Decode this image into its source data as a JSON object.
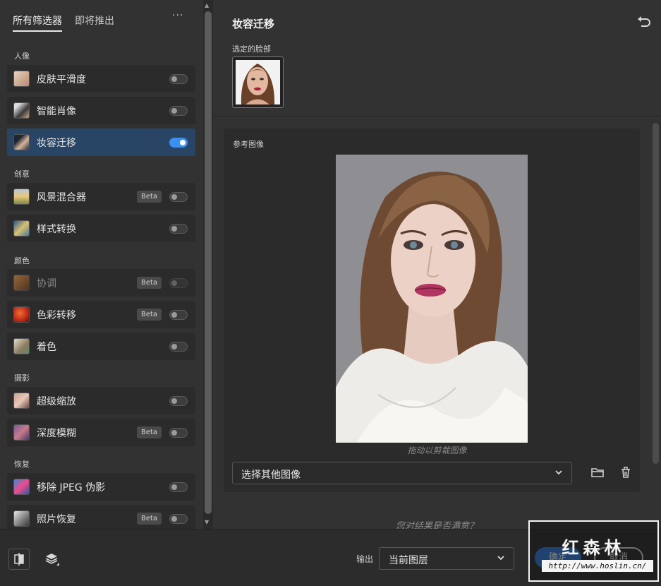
{
  "left_panel": {
    "tabs": [
      {
        "label": "所有筛选器",
        "active": true
      },
      {
        "label": "即将推出",
        "active": false
      }
    ],
    "more_label": "···",
    "sections": [
      {
        "title": "人像",
        "items": [
          {
            "label": "皮肤平滑度",
            "enabled": false,
            "beta": false
          },
          {
            "label": "智能肖像",
            "enabled": false,
            "beta": false
          },
          {
            "label": "妆容迁移",
            "enabled": true,
            "beta": false,
            "selected": true
          }
        ]
      },
      {
        "title": "创意",
        "items": [
          {
            "label": "风景混合器",
            "enabled": false,
            "beta": true
          },
          {
            "label": "样式转换",
            "enabled": false,
            "beta": false
          }
        ]
      },
      {
        "title": "颜色",
        "items": [
          {
            "label": "协调",
            "enabled": false,
            "beta": true,
            "disabled": true
          },
          {
            "label": "色彩转移",
            "enabled": false,
            "beta": true
          },
          {
            "label": "着色",
            "enabled": false,
            "beta": false
          }
        ]
      },
      {
        "title": "摄影",
        "items": [
          {
            "label": "超级缩放",
            "enabled": false,
            "beta": false
          },
          {
            "label": "深度模糊",
            "enabled": false,
            "beta": true
          }
        ]
      },
      {
        "title": "恢复",
        "items": [
          {
            "label": "移除 JPEG 伪影",
            "enabled": false,
            "beta": false
          },
          {
            "label": "照片恢复",
            "enabled": false,
            "beta": true
          }
        ]
      }
    ],
    "beta_label": "Beta"
  },
  "right_panel": {
    "title": "妆容迁移",
    "selected_face_label": "选定的脸部",
    "reference_label": "参考图像",
    "drag_hint": "拖动以剪裁图像",
    "select_image": "选择其他图像",
    "feedback": "您对结果是否满意？"
  },
  "bottom_bar": {
    "output_label": "输出",
    "output_value": "当前图层",
    "ok_label": "确定",
    "cancel_label": "取消"
  },
  "watermark": {
    "title": "红森林",
    "url": "http://www.hoslin.cn/"
  },
  "colors": {
    "accent": "#3b8ff0",
    "selected_item": "#284566",
    "panel_bg": "#323232"
  }
}
